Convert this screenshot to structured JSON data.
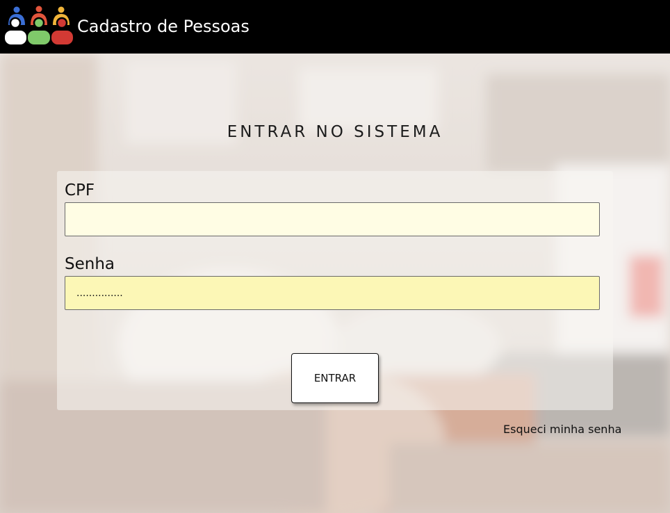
{
  "header": {
    "logo_icon": "people-group-icon",
    "title": "Cadastro de Pessoas"
  },
  "login": {
    "heading": "ENTRAR NO SISTEMA",
    "cpf_label": "CPF",
    "cpf_value": "",
    "senha_label": "Senha",
    "senha_value": "...............",
    "submit_label": "ENTRAR",
    "forgot_link": "Esqueci minha senha"
  },
  "colors": {
    "header_bg": "#000000",
    "cpf_field_bg": "#fffde4",
    "senha_field_bg": "#fcf7b6",
    "person_blue": "#3b6fd6",
    "person_green": "#7fc96a",
    "person_red": "#d23a34",
    "person_orange": "#f0b43a"
  }
}
